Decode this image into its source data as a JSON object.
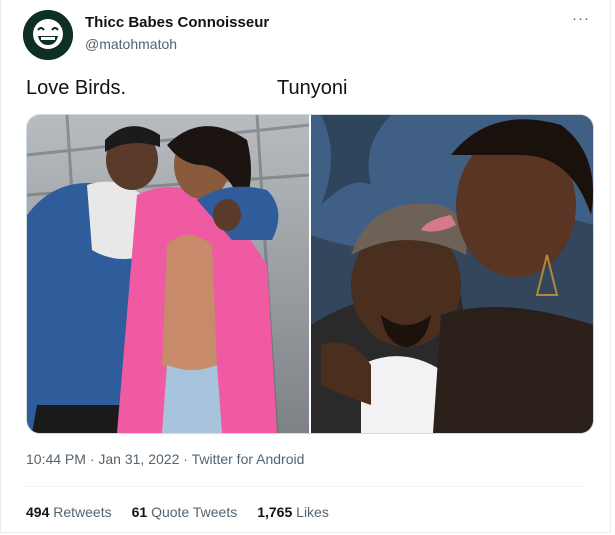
{
  "tweet": {
    "display_name": "Thicc Babes Connoisseur",
    "handle": "@matohmatoh",
    "more_label": "···",
    "caption_left": "Love Birds.",
    "caption_right": "Tunyoni",
    "time": "10:44 PM",
    "separator": "·",
    "date": "Jan 31, 2022",
    "source": "Twitter for Android"
  },
  "stats": {
    "retweets_count": "494",
    "retweets_label": "Retweets",
    "quotes_count": "61",
    "quotes_label": "Quote Tweets",
    "likes_count": "1,765",
    "likes_label": "Likes"
  },
  "icons": {
    "avatar": "grinning-face-icon",
    "more": "more-horizontal-icon"
  },
  "colors": {
    "text_primary": "#0f1419",
    "text_secondary": "#536471",
    "border": "#cfd9de",
    "avatar_bg": "#0e2f23"
  }
}
